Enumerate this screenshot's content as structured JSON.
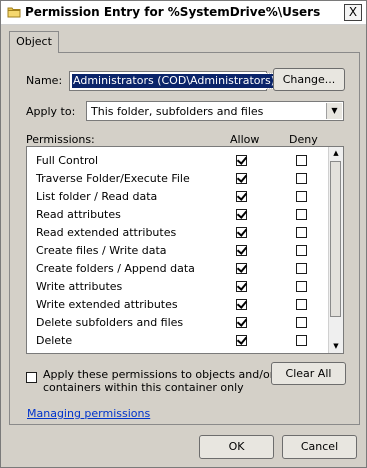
{
  "window": {
    "title": "Permission Entry for %SystemDrive%\\Users",
    "close_label": "X"
  },
  "tabs": [
    {
      "label": "Object"
    }
  ],
  "name": {
    "label": "Name:",
    "value": "Administrators (COD\\Administrators)",
    "change_button": "Change..."
  },
  "apply_to": {
    "label": "Apply to:",
    "selected": "This folder, subfolders and files"
  },
  "permissions": {
    "header_label": "Permissions:",
    "allow_header": "Allow",
    "deny_header": "Deny",
    "rows": [
      {
        "name": "Full Control",
        "allow": true,
        "deny": false
      },
      {
        "name": "Traverse Folder/Execute File",
        "allow": true,
        "deny": false
      },
      {
        "name": "List folder / Read data",
        "allow": true,
        "deny": false
      },
      {
        "name": "Read attributes",
        "allow": true,
        "deny": false
      },
      {
        "name": "Read extended attributes",
        "allow": true,
        "deny": false
      },
      {
        "name": "Create files / Write data",
        "allow": true,
        "deny": false
      },
      {
        "name": "Create folders / Append data",
        "allow": true,
        "deny": false
      },
      {
        "name": "Write attributes",
        "allow": true,
        "deny": false
      },
      {
        "name": "Write extended attributes",
        "allow": true,
        "deny": false
      },
      {
        "name": "Delete subfolders and files",
        "allow": true,
        "deny": false
      },
      {
        "name": "Delete",
        "allow": true,
        "deny": false
      },
      {
        "name": "",
        "allow": true,
        "deny": false
      }
    ]
  },
  "apply_inherit": {
    "checked": false,
    "line1": "Apply these permissions to objects and/or",
    "line2": "containers within this container only"
  },
  "clear_all_button": "Clear All",
  "managing_link": "Managing permissions",
  "footer": {
    "ok": "OK",
    "cancel": "Cancel"
  }
}
